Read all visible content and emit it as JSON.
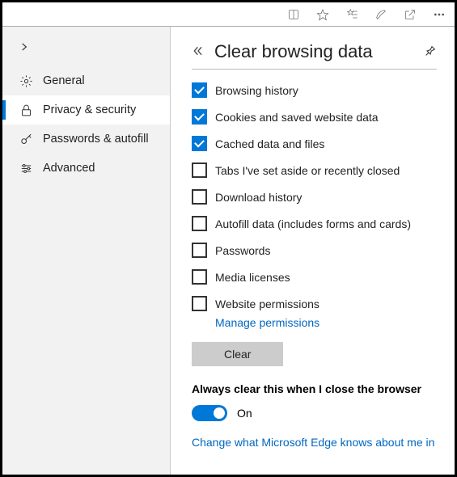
{
  "titlebar": {
    "icons": [
      "reading-view",
      "favorite-star",
      "favorites-list",
      "notes",
      "share",
      "more"
    ]
  },
  "sidebar": {
    "items": [
      {
        "label": "General",
        "icon": "gear"
      },
      {
        "label": "Privacy & security",
        "icon": "lock"
      },
      {
        "label": "Passwords & autofill",
        "icon": "key"
      },
      {
        "label": "Advanced",
        "icon": "sliders"
      }
    ]
  },
  "main": {
    "title": "Clear browsing data",
    "options": [
      {
        "label": "Browsing history",
        "checked": true
      },
      {
        "label": "Cookies and saved website data",
        "checked": true
      },
      {
        "label": "Cached data and files",
        "checked": true
      },
      {
        "label": "Tabs I've set aside or recently closed",
        "checked": false
      },
      {
        "label": "Download history",
        "checked": false
      },
      {
        "label": "Autofill data (includes forms and cards)",
        "checked": false
      },
      {
        "label": "Passwords",
        "checked": false
      },
      {
        "label": "Media licenses",
        "checked": false
      },
      {
        "label": "Website permissions",
        "checked": false
      }
    ],
    "manage_link": "Manage permissions",
    "clear_button": "Clear",
    "always_clear_label": "Always clear this when I close the browser",
    "toggle_state": "On",
    "bottom_link": "Change what Microsoft Edge knows about me in"
  }
}
